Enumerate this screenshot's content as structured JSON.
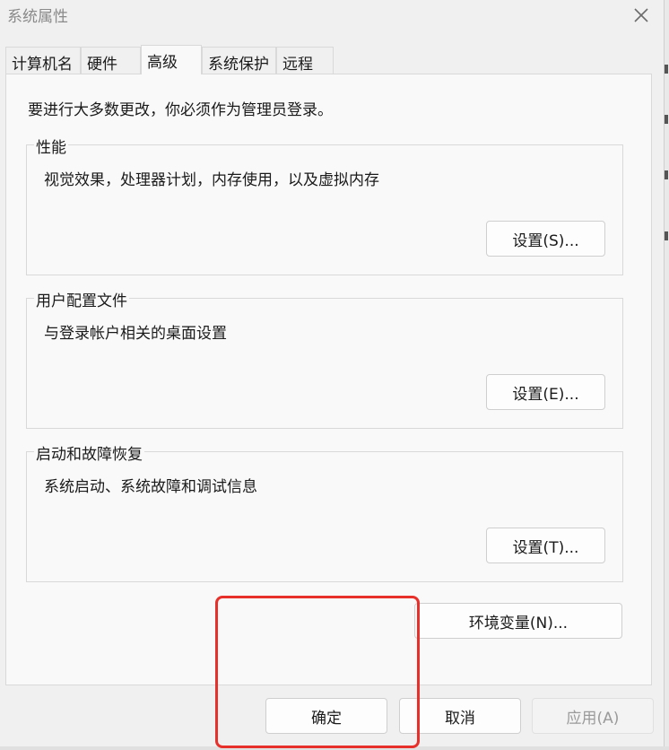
{
  "window": {
    "title": "系统属性"
  },
  "tabs": [
    {
      "label": "计算机名"
    },
    {
      "label": "硬件"
    },
    {
      "label": "高级"
    },
    {
      "label": "系统保护"
    },
    {
      "label": "远程"
    }
  ],
  "active_tab": "高级",
  "admin_note": "要进行大多数更改，你必须作为管理员登录。",
  "groups": {
    "performance": {
      "label": "性能",
      "desc": "视觉效果，处理器计划，内存使用，以及虚拟内存",
      "button": "设置(S)..."
    },
    "profiles": {
      "label": "用户配置文件",
      "desc": "与登录帐户相关的桌面设置",
      "button": "设置(E)..."
    },
    "startup": {
      "label": "启动和故障恢复",
      "desc": "系统启动、系统故障和调试信息",
      "button": "设置(T)..."
    }
  },
  "env_button": "环境变量(N)...",
  "footer": {
    "ok": "确定",
    "cancel": "取消",
    "apply": "应用(A)"
  },
  "colors": {
    "highlight": "#e8302a",
    "panel": "#f9f9f9",
    "dialog": "#f0f0f0"
  },
  "icons": {
    "close": "close-icon"
  }
}
